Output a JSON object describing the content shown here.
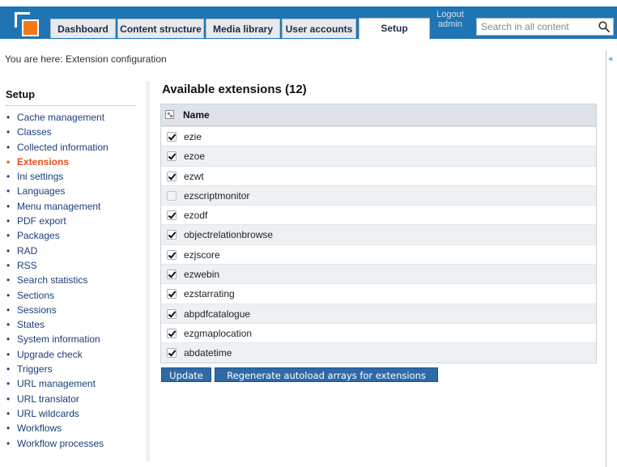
{
  "header": {
    "tabs": [
      {
        "label": "Dashboard",
        "active": false
      },
      {
        "label": "Content structure",
        "active": false
      },
      {
        "label": "Media library",
        "active": false
      },
      {
        "label": "User accounts",
        "active": false
      },
      {
        "label": "Setup",
        "active": true
      }
    ],
    "logout_label": "Logout",
    "user_label": "admin",
    "search_placeholder": "Search in all content",
    "search_value": ""
  },
  "breadcrumb": "You are here: Extension configuration",
  "rail": {
    "collapse_glyph": "«"
  },
  "sidebar": {
    "title": "Setup",
    "items": [
      {
        "label": "Cache management",
        "active": false
      },
      {
        "label": "Classes",
        "active": false
      },
      {
        "label": "Collected information",
        "active": false
      },
      {
        "label": "Extensions",
        "active": true
      },
      {
        "label": "Ini settings",
        "active": false
      },
      {
        "label": "Languages",
        "active": false
      },
      {
        "label": "Menu management",
        "active": false
      },
      {
        "label": "PDF export",
        "active": false
      },
      {
        "label": "Packages",
        "active": false
      },
      {
        "label": "RAD",
        "active": false
      },
      {
        "label": "RSS",
        "active": false
      },
      {
        "label": "Search statistics",
        "active": false
      },
      {
        "label": "Sections",
        "active": false
      },
      {
        "label": "Sessions",
        "active": false
      },
      {
        "label": "States",
        "active": false
      },
      {
        "label": "System information",
        "active": false
      },
      {
        "label": "Upgrade check",
        "active": false
      },
      {
        "label": "Triggers",
        "active": false
      },
      {
        "label": "URL management",
        "active": false
      },
      {
        "label": "URL translator",
        "active": false
      },
      {
        "label": "URL wildcards",
        "active": false
      },
      {
        "label": "Workflows",
        "active": false
      },
      {
        "label": "Workflow processes",
        "active": false
      }
    ]
  },
  "main": {
    "title": "Available extensions (12)",
    "column_name": "Name",
    "extensions": [
      {
        "name": "ezie",
        "checked": true
      },
      {
        "name": "ezoe",
        "checked": true
      },
      {
        "name": "ezwt",
        "checked": true
      },
      {
        "name": "ezscriptmonitor",
        "checked": false
      },
      {
        "name": "ezodf",
        "checked": true
      },
      {
        "name": "objectrelationbrowse",
        "checked": true
      },
      {
        "name": "ezjscore",
        "checked": true
      },
      {
        "name": "ezwebin",
        "checked": true
      },
      {
        "name": "ezstarrating",
        "checked": true
      },
      {
        "name": "abpdfcatalogue",
        "checked": true
      },
      {
        "name": "ezgmaplocation",
        "checked": true
      },
      {
        "name": "abdatetime",
        "checked": true
      }
    ],
    "update_button": "Update",
    "regenerate_button": "Regenerate autoload arrays for extensions"
  }
}
